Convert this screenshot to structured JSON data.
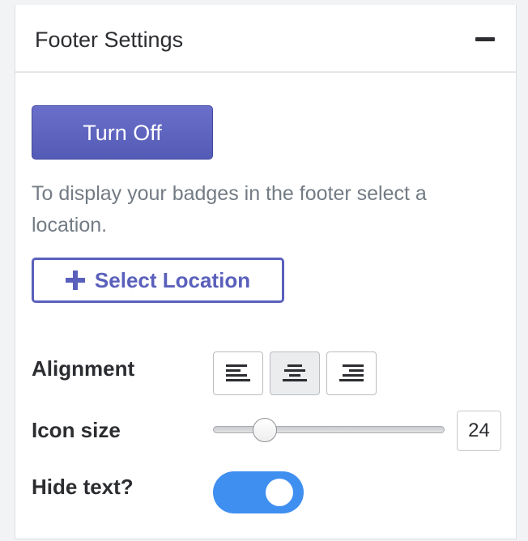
{
  "panel": {
    "title": "Footer Settings",
    "collapse_icon": "minus-icon"
  },
  "turn_off_label": "Turn Off",
  "help_text": "To display your badges in the footer select a location.",
  "select_location": {
    "icon": "plus-icon",
    "label": "Select Location"
  },
  "alignment": {
    "label": "Alignment",
    "options": [
      "align-left-icon",
      "align-center-icon",
      "align-right-icon"
    ],
    "selected": "align-center-icon"
  },
  "icon_size": {
    "label": "Icon size",
    "value": "24",
    "slider_fraction": 0.19
  },
  "hide_text": {
    "label": "Hide text?",
    "on": true
  },
  "colors": {
    "primary": "#5a60bb",
    "toggle_on": "#3f8ff0"
  }
}
